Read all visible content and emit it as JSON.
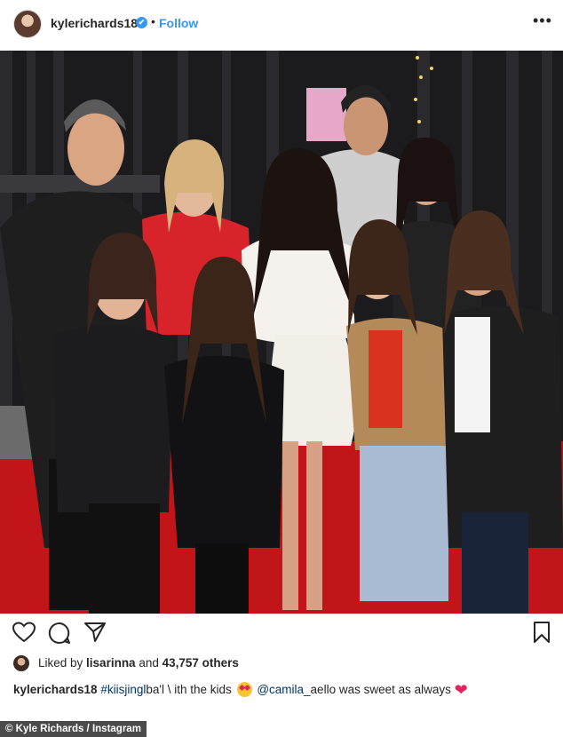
{
  "header": {
    "username": "kylerichards18",
    "verified_badge": "✔",
    "separator": "•",
    "follow_label": "Follow",
    "more_label": "•••"
  },
  "photo": {
    "description_icon": "group-photo-image"
  },
  "actions": {
    "like_icon": "heart-outline-icon",
    "comment_icon": "comment-bubble-icon",
    "share_icon": "send-paper-plane-icon",
    "save_icon": "bookmark-icon"
  },
  "likes": {
    "prefix": "Liked by ",
    "user": "lisarinna",
    "middle": " and ",
    "count": "43,757 others"
  },
  "caption": {
    "username": "kylerichards18",
    "hashtag": "#kiisjingl",
    "hashtag_tail": "ba'l",
    "text1": " \\ ith th",
    "text1b": "e kids",
    "mention": "@camila_",
    "mention_tail": "ae",
    "text2": "llo was sweet as always"
  },
  "credit": {
    "label": "© Kyle Richards / Instagram"
  },
  "colors": {
    "link": "#3897f0",
    "tag": "#003569",
    "heart": "#e0245e",
    "carpet": "#c2151a"
  }
}
